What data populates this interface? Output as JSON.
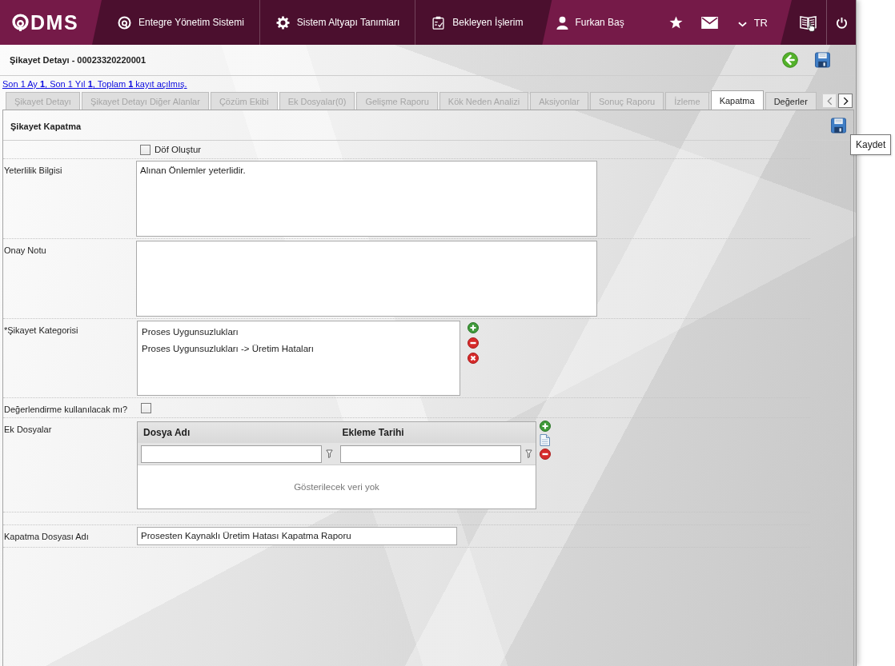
{
  "header": {
    "logo": "DMS",
    "nav": [
      "Entegre Yönetim Sistemi",
      "Sistem Altyapı Tanımları",
      "Bekleyen İşlerim"
    ],
    "user": "Furkan Baş",
    "language": "TR"
  },
  "page": {
    "title": "Şikayet Detayı - 00023320220001",
    "history_link": "Son 1 Ay **1**, Son 1 Yıl **1**, Toplam **1** kayıt açılmış."
  },
  "tabs": [
    {
      "label": "Şikayet Detayı",
      "selected": false,
      "disabled": true
    },
    {
      "label": "Şikayet Detayı Diğer Alanlar",
      "selected": false,
      "disabled": true
    },
    {
      "label": "Çözüm Ekibi",
      "selected": false,
      "disabled": true
    },
    {
      "label": "Ek Dosyalar(0)",
      "selected": false,
      "disabled": true
    },
    {
      "label": "Gelişme Raporu",
      "selected": false,
      "disabled": true
    },
    {
      "label": "Kök Neden Analizi",
      "selected": false,
      "disabled": true
    },
    {
      "label": "Aksiyonlar",
      "selected": false,
      "disabled": true
    },
    {
      "label": "Sonuç Raporu",
      "selected": false,
      "disabled": true
    },
    {
      "label": "İzleme",
      "selected": false,
      "disabled": true
    },
    {
      "label": "Kapatma",
      "selected": true,
      "disabled": false
    },
    {
      "label": "Değerler",
      "selected": false,
      "disabled": false
    }
  ],
  "section": {
    "title": "Şikayet Kapatma",
    "tooltip": "Kaydet"
  },
  "form": [
    {
      "kind": "checkbox",
      "option": "Döf Oluştur",
      "checked": false
    },
    {
      "kind": "textarea",
      "label": "Yeterlilik Bilgisi",
      "value": "Alınan Önlemler yeterlidir."
    },
    {
      "kind": "textarea",
      "label": "Onay Notu"
    },
    {
      "kind": "listbox",
      "label": "*Şikayet Kategorisi",
      "items": [
        "Proses Uygunsuzlukları",
        "Proses Uygunsuzlukları -> Üretim Hataları"
      ]
    },
    {
      "kind": "checkbox",
      "label": "Değerlendirme kullanılacak mı?",
      "checked": false
    },
    {
      "kind": "grid",
      "label": "Ek Dosyalar",
      "columns": [
        "Dosya Adı",
        "Ekleme Tarihi"
      ],
      "empty_text": "Gösterilecek veri yok"
    },
    {
      "kind": "input",
      "label": "Kapatma Dosyası Adı",
      "value": "Prosesten Kaynaklı Üretim Hatası Kapatma Raporu"
    }
  ]
}
